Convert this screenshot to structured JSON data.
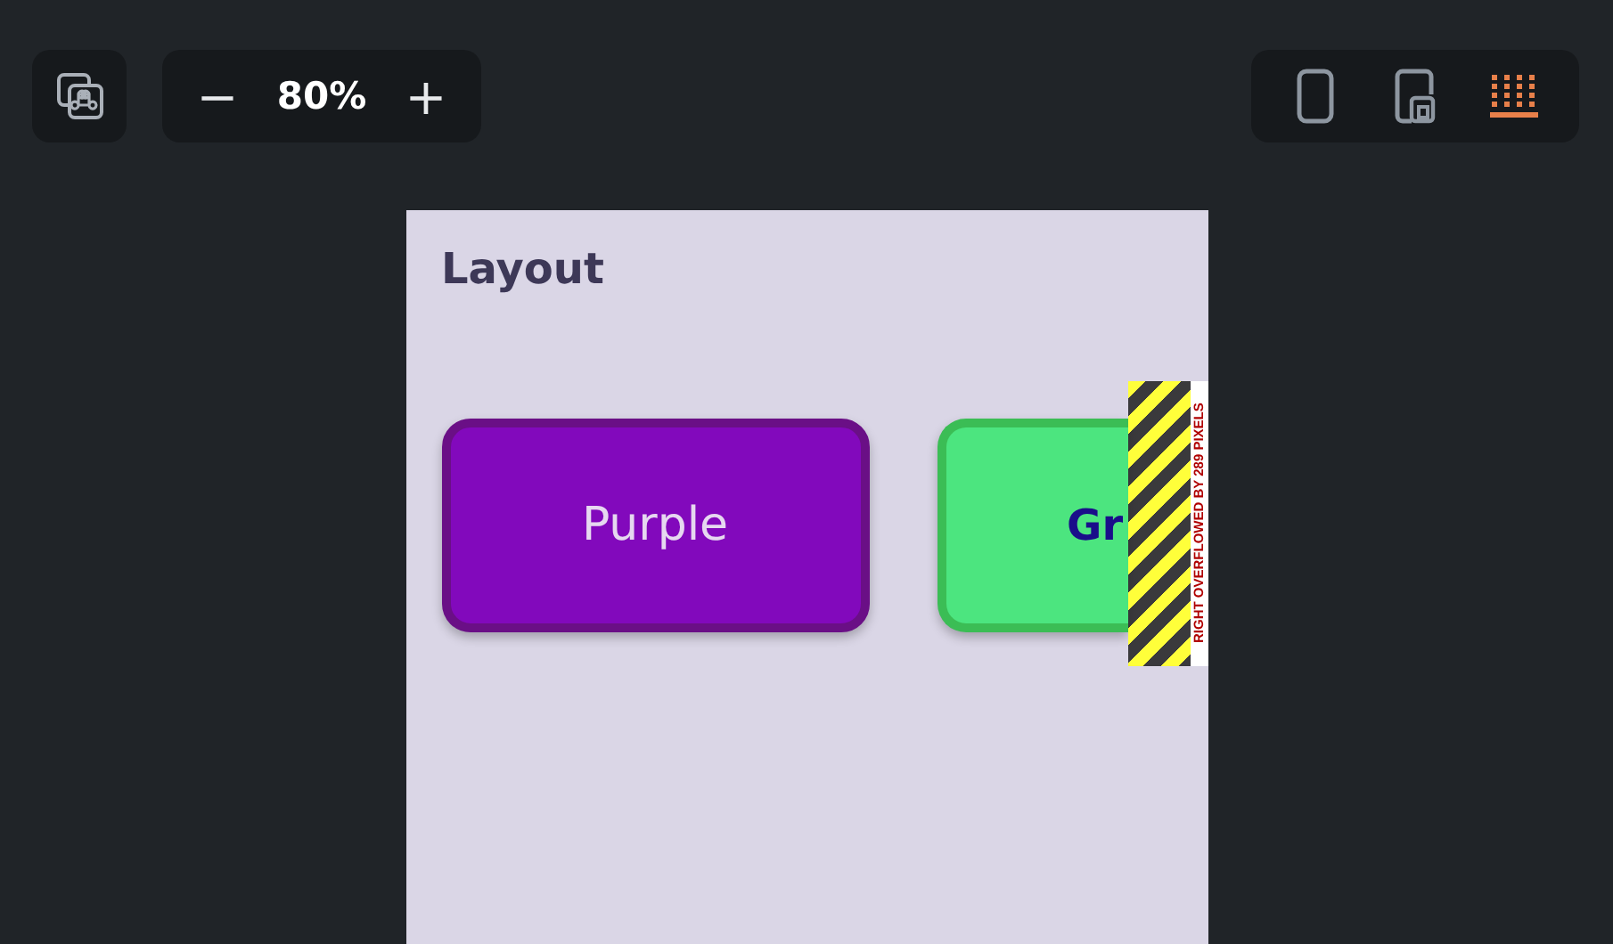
{
  "toolbar": {
    "zoom": {
      "minus": "−",
      "value": "80%",
      "plus": "+"
    },
    "devices": [
      {
        "kind": "phone",
        "selected": false
      },
      {
        "kind": "tablet",
        "selected": false
      },
      {
        "kind": "grid",
        "selected": true
      }
    ]
  },
  "preview": {
    "title": "Layout",
    "buttons": [
      {
        "label": "Purple",
        "color": "#8209bc"
      },
      {
        "label": "Gr",
        "color": "#4ce57f"
      }
    ],
    "overflow": {
      "message": "RIGHT OVERFLOWED BY 289 PIXELS"
    }
  }
}
